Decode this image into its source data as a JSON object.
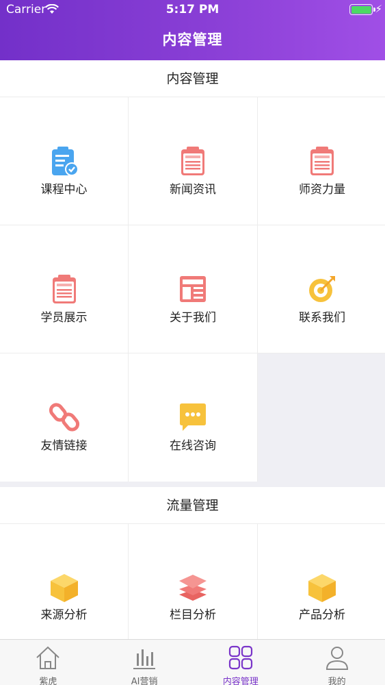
{
  "status_bar": {
    "carrier": "Carrier",
    "time": "5:17 PM"
  },
  "nav": {
    "title": "内容管理"
  },
  "section1": {
    "title": "内容管理",
    "items": [
      {
        "label": "课程中心",
        "icon": "clipboard-check-icon"
      },
      {
        "label": "新闻资讯",
        "icon": "resume-icon"
      },
      {
        "label": "师资力量",
        "icon": "resume-icon"
      },
      {
        "label": "学员展示",
        "icon": "resume-icon"
      },
      {
        "label": "关于我们",
        "icon": "newspaper-icon"
      },
      {
        "label": "联系我们",
        "icon": "target-icon"
      },
      {
        "label": "友情链接",
        "icon": "link-icon"
      },
      {
        "label": "在线咨询",
        "icon": "chat-bubble-icon"
      }
    ]
  },
  "section2": {
    "title": "流量管理",
    "items": [
      {
        "label": "来源分析",
        "icon": "box-icon"
      },
      {
        "label": "栏目分析",
        "icon": "layers-icon"
      },
      {
        "label": "产品分析",
        "icon": "box-icon"
      }
    ]
  },
  "tabbar": {
    "tabs": [
      {
        "label": "紫虎",
        "icon": "home-icon"
      },
      {
        "label": "AI营销",
        "icon": "bar-chart-icon"
      },
      {
        "label": "内容管理",
        "icon": "grid-icon",
        "active": true
      },
      {
        "label": "我的",
        "icon": "user-icon"
      }
    ]
  },
  "colors": {
    "accent": "#7a35c9",
    "header_start": "#7330c9",
    "header_end": "#a04fe6",
    "resume_red": "#f07a78",
    "gold": "#f7c23c",
    "blue": "#4aa5ef"
  }
}
